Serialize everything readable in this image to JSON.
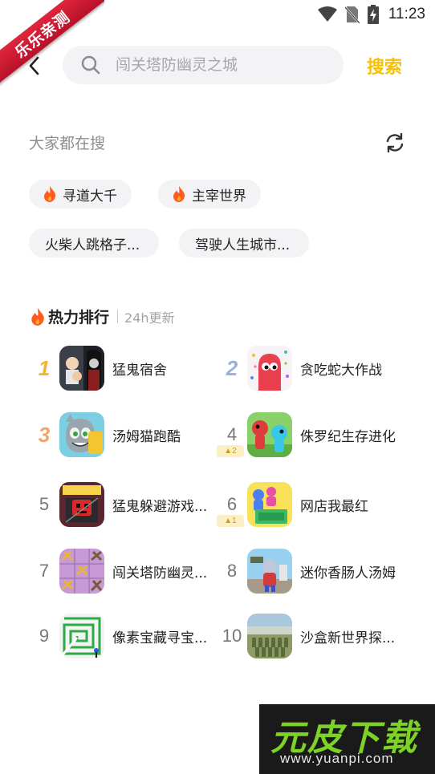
{
  "ribbon": {
    "text": "乐乐亲测"
  },
  "status_bar": {
    "time": "11:23"
  },
  "search": {
    "placeholder": "闯关塔防幽灵之城",
    "button_label": "搜索"
  },
  "hot_searches": {
    "title": "大家都在搜",
    "chips": [
      {
        "label": "寻道大千",
        "hot": true
      },
      {
        "label": "主宰世界",
        "hot": true
      },
      {
        "label": "火柴人跳格子...",
        "hot": false
      },
      {
        "label": "驾驶人生城市...",
        "hot": false
      }
    ]
  },
  "ranking": {
    "title": "热力排行",
    "subtitle": "24h更新",
    "items": [
      {
        "rank": "1",
        "name": "猛鬼宿舍",
        "icon": "ghost-dorm-icon"
      },
      {
        "rank": "2",
        "name": "贪吃蛇大作战",
        "icon": "snake-battle-icon"
      },
      {
        "rank": "3",
        "name": "汤姆猫跑酷",
        "icon": "tom-cat-run-icon"
      },
      {
        "rank": "4",
        "name": "侏罗纪生存进化",
        "icon": "jurassic-icon",
        "change": "2"
      },
      {
        "rank": "5",
        "name": "猛鬼躲避游戏...",
        "icon": "ghost-escape-icon"
      },
      {
        "rank": "6",
        "name": "网店我最红",
        "icon": "online-shop-icon",
        "change": "1"
      },
      {
        "rank": "7",
        "name": "闯关塔防幽灵...",
        "icon": "tower-defense-icon"
      },
      {
        "rank": "8",
        "name": "迷你香肠人汤姆",
        "icon": "sausage-man-icon"
      },
      {
        "rank": "9",
        "name": "像素宝藏寻宝...",
        "icon": "pixel-maze-icon"
      },
      {
        "rank": "10",
        "name": "沙盒新世界探...",
        "icon": "sandbox-army-icon"
      }
    ]
  },
  "watermark": {
    "brand": "元皮下载",
    "url": "www.yuanpi.com"
  },
  "colors": {
    "accent": "#f4c10c",
    "chip_bg": "#f3f3f5",
    "ribbon": "#d11a33"
  }
}
